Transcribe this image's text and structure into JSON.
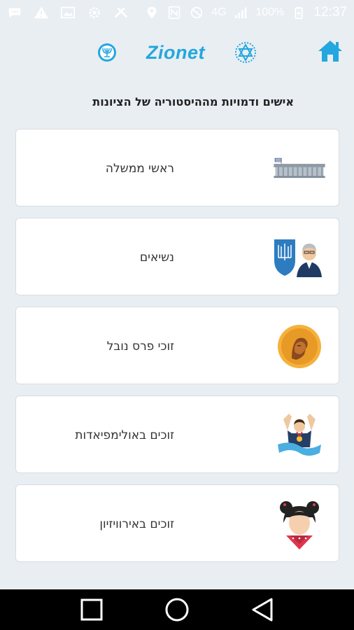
{
  "status_bar": {
    "battery_percent": "100%",
    "time": "12:37",
    "network_type": "4G",
    "icons_left": [
      "message-icon",
      "warning-icon",
      "image-icon",
      "settings-icon",
      "tools-icon"
    ],
    "icons_right": [
      "location-icon",
      "nfc-icon",
      "mute-icon",
      "signal-icon",
      "battery-icon"
    ]
  },
  "header": {
    "brand": "Zionet",
    "left_emblem": "menorah-emblem-icon",
    "right_emblem": "star-of-david-icon",
    "home_icon": "home-icon"
  },
  "page": {
    "title": "אישים ודמויות מההיסטוריה של הציונות"
  },
  "categories": [
    {
      "label": "ראשי ממשלה",
      "icon": "knesset-building-icon"
    },
    {
      "label": "נשיאים",
      "icon": "president-icon"
    },
    {
      "label": "זוכי פרס נובל",
      "icon": "nobel-medal-icon"
    },
    {
      "label": "זוכים באולימפיאדות",
      "icon": "olympic-winner-icon"
    },
    {
      "label": "זוכים באירוויזיון",
      "icon": "eurovision-singer-icon"
    }
  ],
  "nav": {
    "recents": "recents-square-icon",
    "home": "home-circle-icon",
    "back": "back-triangle-icon"
  },
  "colors": {
    "brand": "#23a7de",
    "background": "#e9eef2",
    "card": "#ffffff"
  }
}
